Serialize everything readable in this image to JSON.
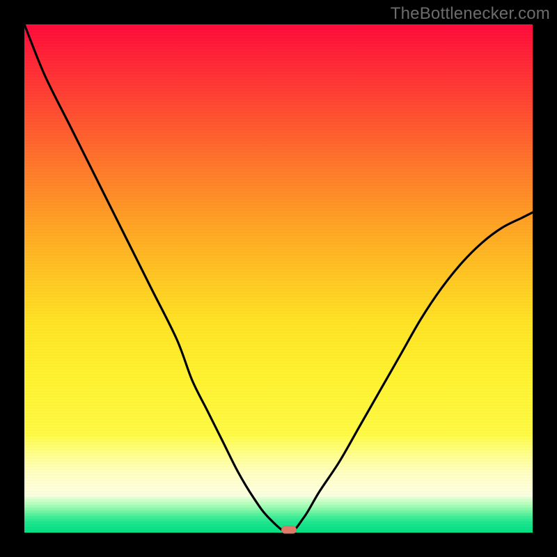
{
  "watermark": {
    "text": "TheBottlenecker.com"
  },
  "chart_data": {
    "type": "line",
    "title": "",
    "xlabel": "",
    "ylabel": "",
    "xlim": [
      0,
      1
    ],
    "ylim": [
      0,
      1
    ],
    "x": [
      0.0,
      0.04,
      0.09,
      0.15,
      0.2,
      0.25,
      0.3,
      0.33,
      0.36,
      0.39,
      0.42,
      0.45,
      0.48,
      0.52,
      0.55,
      0.58,
      0.62,
      0.66,
      0.7,
      0.74,
      0.78,
      0.82,
      0.86,
      0.9,
      0.94,
      0.98,
      1.0
    ],
    "y": [
      1.0,
      0.9,
      0.8,
      0.68,
      0.58,
      0.48,
      0.38,
      0.3,
      0.24,
      0.18,
      0.12,
      0.07,
      0.03,
      0.0,
      0.03,
      0.08,
      0.14,
      0.21,
      0.28,
      0.35,
      0.42,
      0.48,
      0.53,
      0.57,
      0.6,
      0.62,
      0.63
    ],
    "minimum": {
      "x": 0.52,
      "y": 0.005
    },
    "background_gradient": {
      "stops": [
        {
          "pos": 0.0,
          "color": "#ff0a3a"
        },
        {
          "pos": 0.34,
          "color": "#ff7a2a"
        },
        {
          "pos": 0.7,
          "color": "#ffe324"
        },
        {
          "pos": 0.86,
          "color": "#ffffc0"
        },
        {
          "pos": 0.95,
          "color": "#4bef99"
        },
        {
          "pos": 1.0,
          "color": "#00df82"
        }
      ]
    },
    "marker": {
      "color": "#de7a68",
      "shape": "pill"
    }
  }
}
